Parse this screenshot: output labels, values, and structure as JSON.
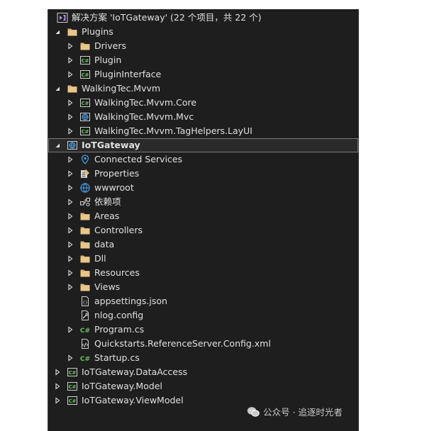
{
  "solution_explorer": {
    "solution_label": "解决方案 'IoTGateway' (22 个项目，共 22 个)",
    "items": [
      {
        "label": "Plugins",
        "icon": "folder-icon",
        "state": "expanded"
      },
      {
        "label": "Drivers",
        "icon": "folder-icon",
        "state": "collapsed"
      },
      {
        "label": "Plugin",
        "icon": "csharp-project-icon",
        "state": "collapsed"
      },
      {
        "label": "PluginInterface",
        "icon": "csharp-project-icon",
        "state": "collapsed"
      },
      {
        "label": "WalkingTec.Mvvm",
        "icon": "folder-icon",
        "state": "expanded"
      },
      {
        "label": "WalkingTec.Mvvm.Core",
        "icon": "csharp-project-icon",
        "state": "collapsed"
      },
      {
        "label": "WalkingTec.Mvvm.Mvc",
        "icon": "web-project-icon",
        "state": "collapsed"
      },
      {
        "label": "WalkingTec.Mvvm.TagHelpers.LayUI",
        "icon": "csharp-project-icon",
        "state": "collapsed"
      },
      {
        "label": "IoTGateway",
        "icon": "web-project-icon",
        "state": "expanded",
        "selected": true
      },
      {
        "label": "Connected Services",
        "icon": "connected-services-icon",
        "state": "collapsed"
      },
      {
        "label": "Properties",
        "icon": "properties-icon",
        "state": "collapsed"
      },
      {
        "label": "wwwroot",
        "icon": "globe-icon",
        "state": "collapsed"
      },
      {
        "label": "依赖项",
        "icon": "dependencies-icon",
        "state": "collapsed"
      },
      {
        "label": "Areas",
        "icon": "folder-icon",
        "state": "collapsed"
      },
      {
        "label": "Controllers",
        "icon": "folder-icon",
        "state": "collapsed"
      },
      {
        "label": "data",
        "icon": "folder-icon",
        "state": "collapsed"
      },
      {
        "label": "Dll",
        "icon": "folder-icon",
        "state": "collapsed"
      },
      {
        "label": "Resources",
        "icon": "folder-icon",
        "state": "collapsed"
      },
      {
        "label": "Views",
        "icon": "folder-icon",
        "state": "collapsed"
      },
      {
        "label": "appsettings.json",
        "icon": "json-file-icon",
        "state": "leaf"
      },
      {
        "label": "nlog.config",
        "icon": "config-file-icon",
        "state": "leaf"
      },
      {
        "label": "Program.cs",
        "icon": "csharp-file-icon",
        "state": "collapsed"
      },
      {
        "label": "Quickstarts.ReferenceServer.Config.xml",
        "icon": "xml-file-icon",
        "state": "leaf"
      },
      {
        "label": "Startup.cs",
        "icon": "csharp-file-icon",
        "state": "collapsed"
      },
      {
        "label": "IoTGateway.DataAccess",
        "icon": "csharp-project-icon",
        "state": "collapsed"
      },
      {
        "label": "IoTGateway.Model",
        "icon": "csharp-project-icon",
        "state": "collapsed"
      },
      {
        "label": "IoTGateway.ViewModel",
        "icon": "csharp-project-icon",
        "state": "collapsed"
      }
    ]
  },
  "watermark": {
    "text": "公众号 · 追逐时光者",
    "icon": "wechat-icon"
  },
  "colors": {
    "panel_background": "#1e1e1e",
    "text": "#e0e0e0",
    "folder": "#dcb67a",
    "csharp": "#68c25a",
    "web": "#4aa3f0",
    "solution": "#b48ae6"
  }
}
